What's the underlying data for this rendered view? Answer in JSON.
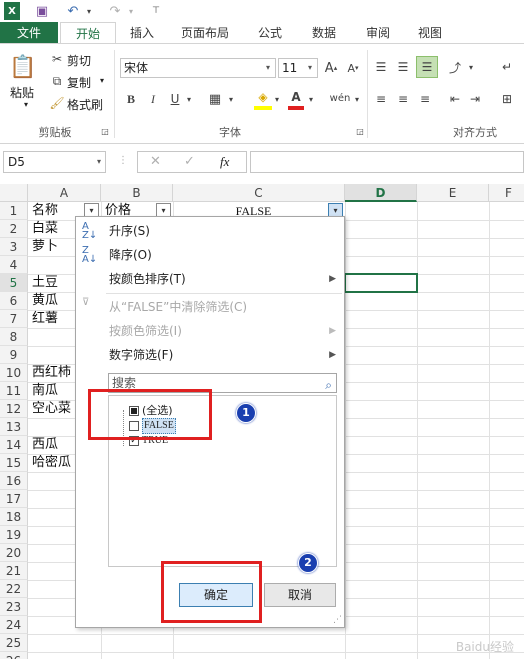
{
  "quick_access": {
    "excel_icon": "excel-logo",
    "save_icon": "save-icon",
    "undo_icon": "undo-icon",
    "redo_icon": "redo-icon"
  },
  "ribbon_tabs": [
    "文件",
    "开始",
    "插入",
    "页面布局",
    "公式",
    "数据",
    "审阅",
    "视图"
  ],
  "clipboard": {
    "paste": "粘贴",
    "cut": "剪切",
    "copy": "复制",
    "format_painter": "格式刷",
    "group_label": "剪贴板"
  },
  "font": {
    "name": "宋体",
    "size": "11",
    "bold": "B",
    "italic": "I",
    "underline": "U",
    "font_color_glyph": "A",
    "phonetic_glyph": "wén",
    "group_label": "字体"
  },
  "alignment": {
    "group_label": "对齐方式"
  },
  "formula_bar": {
    "name_box": "D5",
    "fx": "fx",
    "formula": ""
  },
  "columns": [
    "A",
    "B",
    "C",
    "D",
    "E",
    "F"
  ],
  "rows": [
    "1",
    "2",
    "3",
    "4",
    "5",
    "6",
    "7",
    "8",
    "9",
    "10",
    "11",
    "12",
    "13",
    "14",
    "15",
    "16",
    "17",
    "18",
    "19",
    "20",
    "21",
    "22",
    "23",
    "24",
    "25",
    "26"
  ],
  "cells": {
    "A1": "名称",
    "B1": "价格",
    "C1": "FALSE",
    "A2": "白菜",
    "A3": "萝卜",
    "A5": "土豆",
    "A6": "黄瓜",
    "A7": "红薯",
    "A10": "西红柿",
    "A11": "南瓜",
    "A12": "空心菜",
    "A14": "西瓜",
    "A15": "哈密瓜"
  },
  "filter_menu": {
    "sort_asc": "升序(S)",
    "sort_desc": "降序(O)",
    "sort_by_color": "按颜色排序(T)",
    "clear_filter": "从“FALSE”中清除筛选(C)",
    "filter_by_color": "按颜色筛选(I)",
    "number_filter": "数字筛选(F)",
    "search_placeholder": "搜索",
    "items": [
      {
        "label": "(全选)",
        "state": "partial"
      },
      {
        "label": "FALSE",
        "state": "unchecked"
      },
      {
        "label": "TRUE",
        "state": "checked"
      }
    ],
    "ok": "确定",
    "cancel": "取消"
  },
  "annotations": [
    "1",
    "2"
  ],
  "colors": {
    "file_tab": "#217346",
    "highlight_red": "#e02020",
    "badge_blue": "#1a3fb0"
  }
}
